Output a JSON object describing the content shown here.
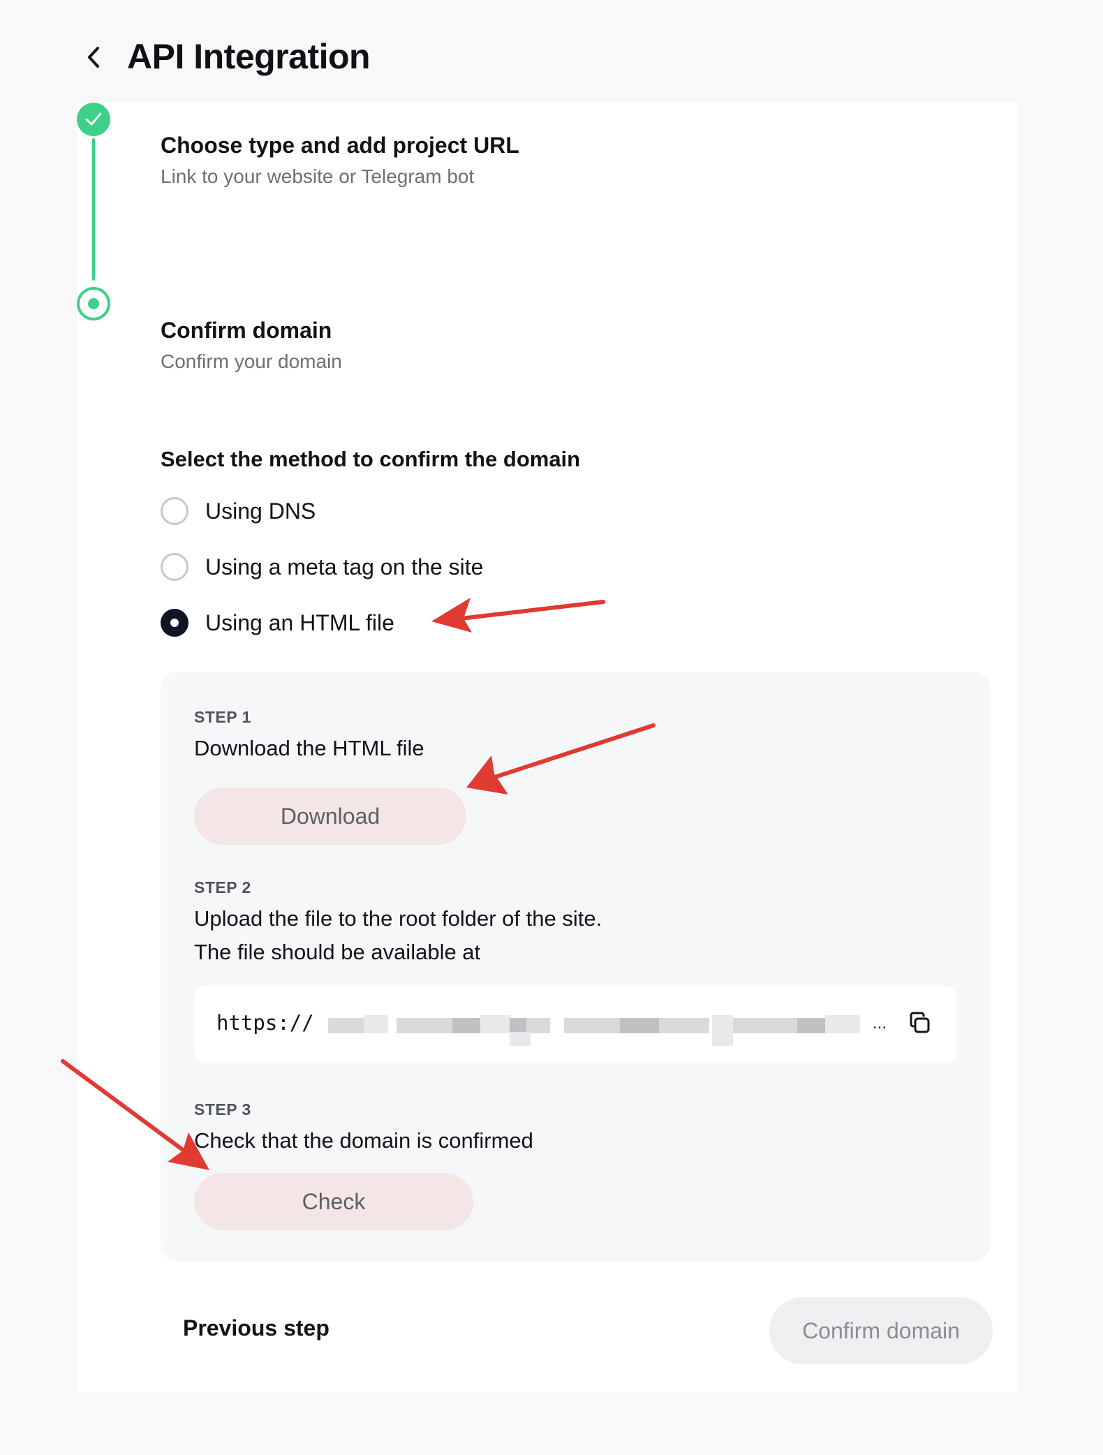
{
  "header": {
    "title": "API Integration",
    "back_icon": "chevron-left-icon"
  },
  "stepper": {
    "steps": [
      {
        "title": "Choose type and add project URL",
        "subtitle": "Link to your website or Telegram bot",
        "status": "completed"
      },
      {
        "title": "Confirm domain",
        "subtitle": "Confirm your domain",
        "status": "active"
      }
    ]
  },
  "method": {
    "label": "Select the method to confirm the domain",
    "options": [
      {
        "label": "Using DNS",
        "selected": false
      },
      {
        "label": "Using a meta tag on the site",
        "selected": false
      },
      {
        "label": "Using an HTML file",
        "selected": true
      }
    ]
  },
  "instructions": {
    "step1": {
      "tag": "STEP 1",
      "text": "Download the HTML file",
      "button": "Download"
    },
    "step2": {
      "tag": "STEP 2",
      "text": "Upload the file to the root folder of the site.",
      "text2": "The file should be available at",
      "url_prefix": "https://",
      "url_ellipsis": "...",
      "copy_icon": "copy-icon"
    },
    "step3": {
      "tag": "STEP 3",
      "text": "Check that the domain is confirmed",
      "button": "Check"
    }
  },
  "footer": {
    "previous": "Previous step",
    "confirm": "Confirm domain"
  },
  "colors": {
    "accent_green": "#3dd08b",
    "radio_selected": "#0f1524",
    "pill_button_bg": "#f4e6e6",
    "annotation_arrow": "#e03a32"
  }
}
